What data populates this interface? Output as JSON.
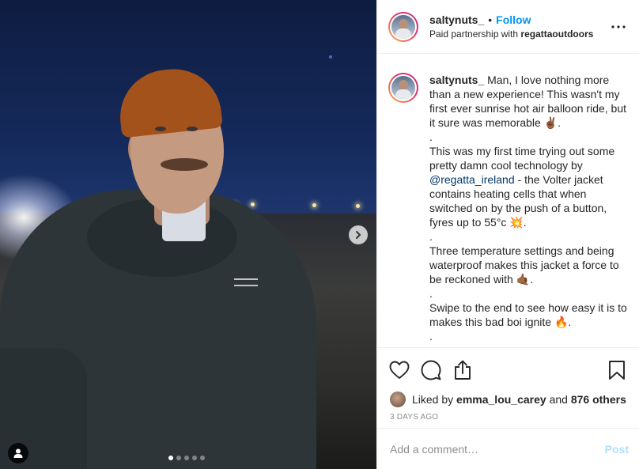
{
  "post": {
    "username": "saltynuts_",
    "separator": "•",
    "follow_label": "Follow",
    "partnership_prefix": "Paid partnership with",
    "partner": "regattaoutdoors",
    "caption_user": "saltynuts_",
    "caption_1": " Man, I love nothing more than a new experience! This wasn't my first ever sunrise hot air balloon ride, but it sure was memorable ✌🏾.\n.\nThis was my first time trying out some pretty damn cool technology by ",
    "mention": "@regatta_ireland",
    "caption_2": " - the Volter jacket contains heating cells that when switched on by the push of a button, fyres up to 55°c 💥.\n.\nThree temperature settings and being waterproof makes this jacket a force to be reckoned with 🤙🏾.\n.\nSwipe to the end to see how easy it is to makes this bad boi ignite 🔥.\n.",
    "liked_by_prefix": "Liked by",
    "liked_by_user": "emma_lou_carey",
    "liked_and": "and",
    "liked_others": "876 others",
    "timestamp": "3 DAYS AGO",
    "comment_placeholder": "Add a comment…",
    "post_label": "Post"
  },
  "carousel": {
    "total": 5,
    "current": 1
  },
  "icons": [
    "more-options-icon",
    "heart-icon",
    "comment-icon",
    "share-icon",
    "bookmark-icon",
    "chevron-right-icon",
    "user-tag-icon"
  ],
  "colors": {
    "follow": "#0095f6",
    "mention": "#00376b",
    "muted": "#8e8e8e",
    "post_disabled": "#b2dffc"
  }
}
